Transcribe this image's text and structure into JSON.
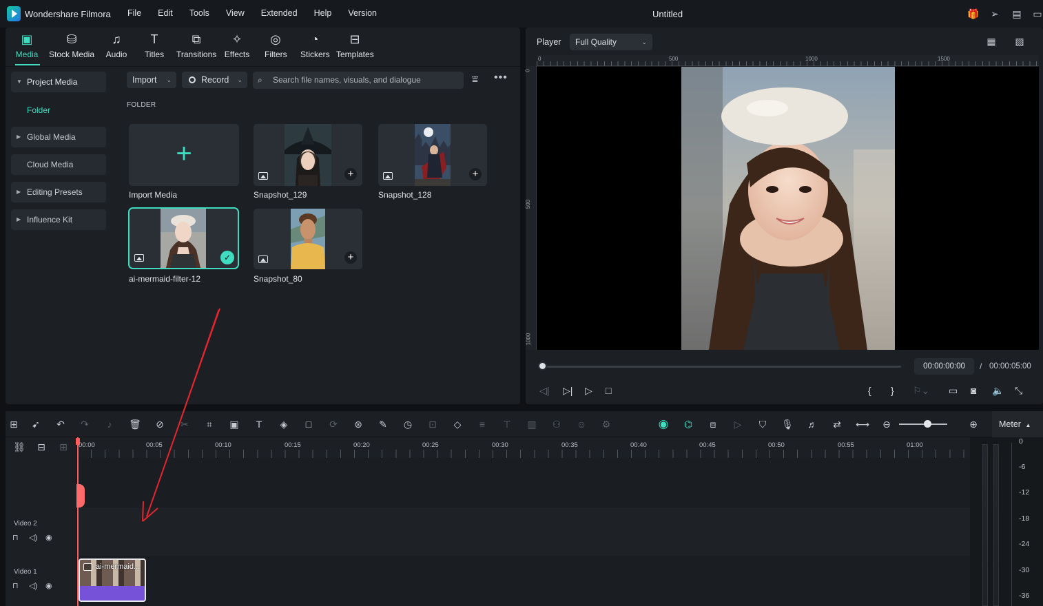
{
  "app": {
    "name": "Wondershare Filmora",
    "document_title": "Untitled"
  },
  "menu": [
    "File",
    "Edit",
    "Tools",
    "View",
    "Extended",
    "Help",
    "Version"
  ],
  "media_tabs": [
    {
      "label": "Media",
      "icon": "media-icon",
      "active": true
    },
    {
      "label": "Stock Media",
      "icon": "stock-media-icon"
    },
    {
      "label": "Audio",
      "icon": "audio-icon"
    },
    {
      "label": "Titles",
      "icon": "titles-icon"
    },
    {
      "label": "Transitions",
      "icon": "transitions-icon"
    },
    {
      "label": "Effects",
      "icon": "effects-icon"
    },
    {
      "label": "Filters",
      "icon": "filters-icon"
    },
    {
      "label": "Stickers",
      "icon": "stickers-icon"
    },
    {
      "label": "Templates",
      "icon": "templates-icon"
    }
  ],
  "sidebar": {
    "project_media": "Project Media",
    "folder": "Folder",
    "global_media": "Global Media",
    "cloud_media": "Cloud Media",
    "editing_presets": "Editing Presets",
    "influence_kit": "Influence Kit"
  },
  "toolbar": {
    "import_label": "Import",
    "record_label": "Record",
    "search_placeholder": "Search file names, visuals, and dialogue"
  },
  "folder_heading": "FOLDER",
  "media_items": {
    "import": "Import Media",
    "item1": "Snapshot_129",
    "item2": "Snapshot_128",
    "item3": "ai-mermaid-filter-12",
    "item4": "Snapshot_80"
  },
  "player": {
    "label": "Player",
    "quality": "Full Quality",
    "ruler_h": [
      "0",
      "500",
      "1000",
      "1500"
    ],
    "ruler_v": [
      "0",
      "500",
      "1000"
    ],
    "current_time": "00:00:00:00",
    "total_time": "00:00:05:00",
    "slash": "/",
    "progress": 0
  },
  "timeline": {
    "meter_label": "Meter",
    "ruler": [
      "00:00",
      "00:05",
      "00:10",
      "00:15",
      "00:20",
      "00:25",
      "00:30",
      "00:35",
      "00:40",
      "00:45",
      "00:50",
      "00:55",
      "01:00"
    ],
    "tracks": [
      {
        "name": "Video 2"
      },
      {
        "name": "Video 1"
      }
    ],
    "clip_label": "ai-mermaid...",
    "db_scale": [
      "0",
      "-6",
      "-12",
      "-18",
      "-24",
      "-30",
      "-36"
    ]
  },
  "colors": {
    "accent": "#3fdcc0",
    "playhead": "#ff5a5a",
    "clip": "#7652d9",
    "annotation_arrow": "#e3262e"
  }
}
